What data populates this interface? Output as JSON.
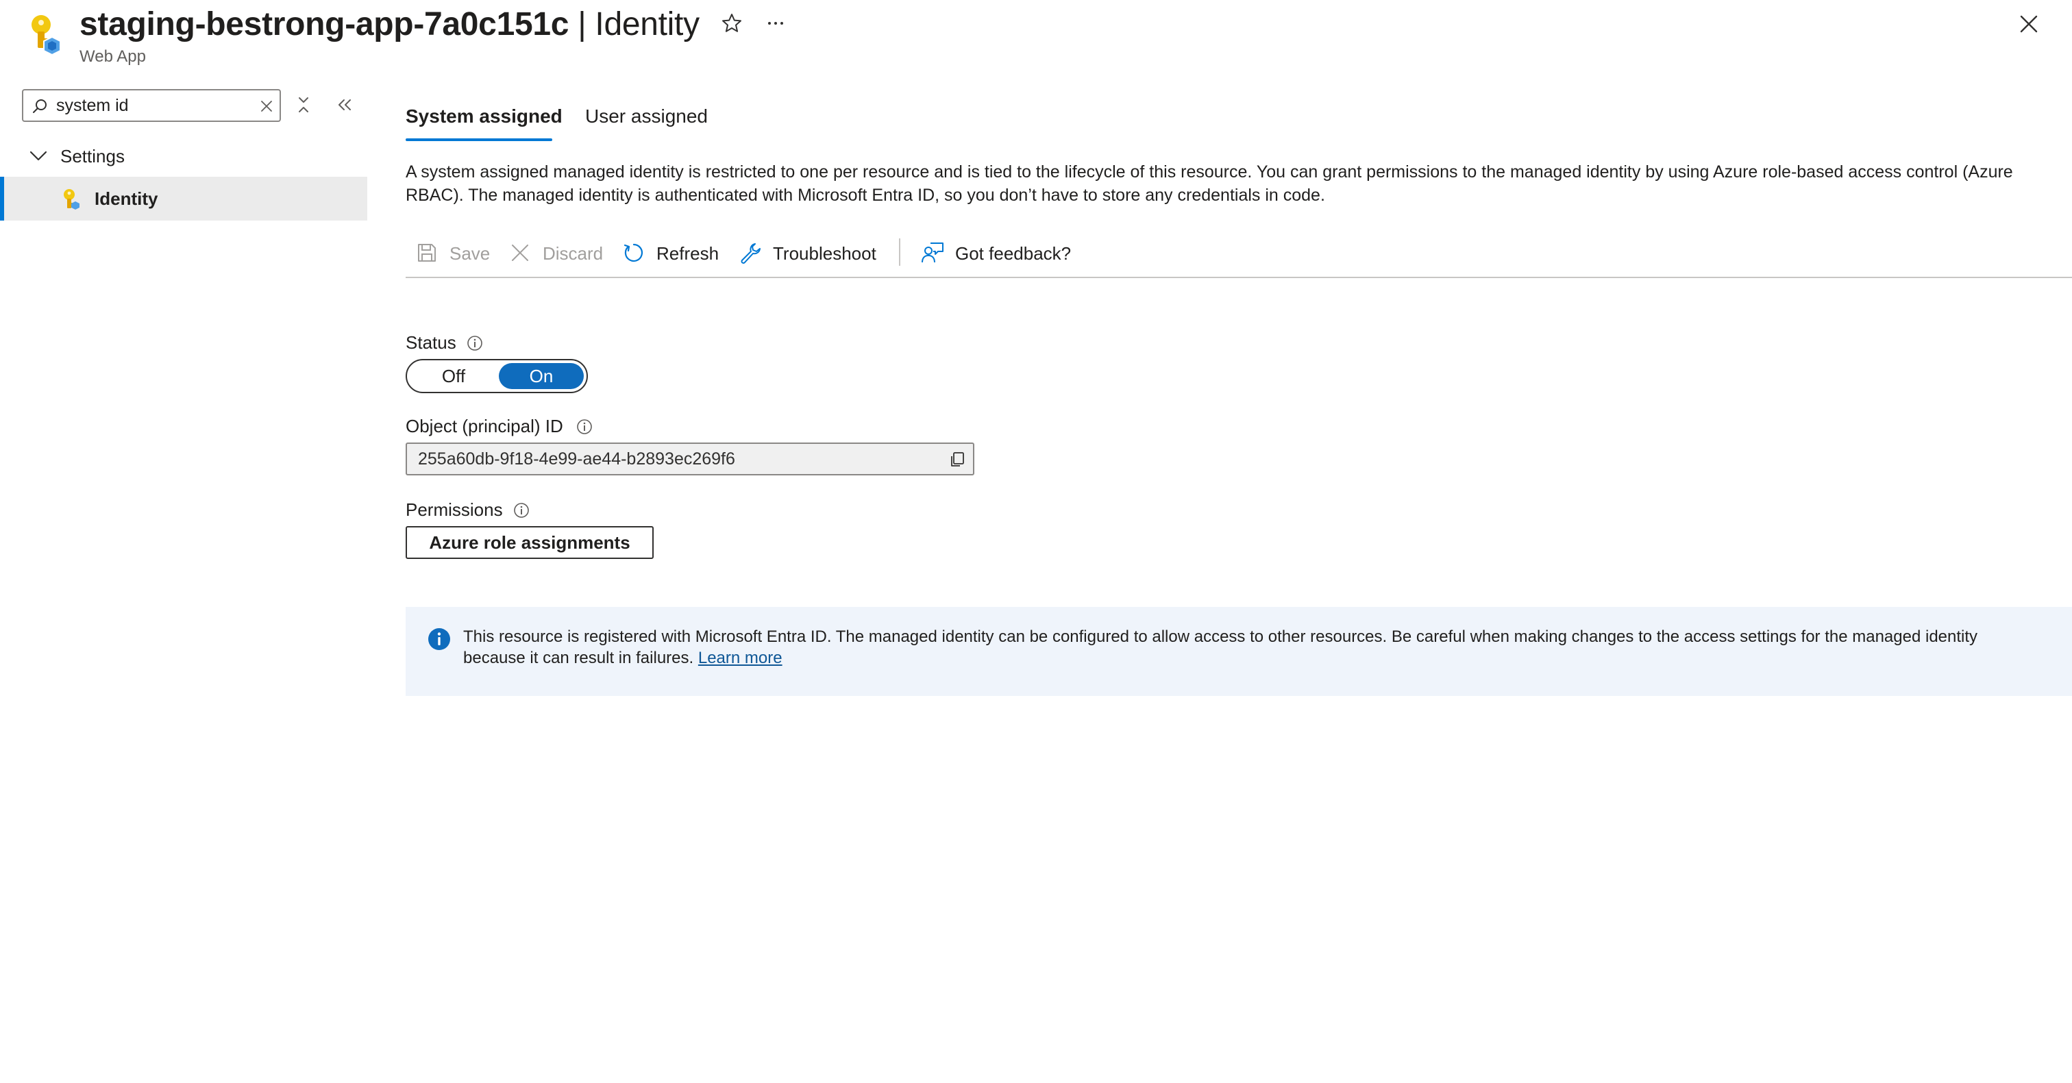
{
  "header": {
    "resource_name": "staging-bestrong-app-7a0c151c",
    "separator": " | ",
    "section": "Identity",
    "subtitle": "Web App"
  },
  "sidebar": {
    "search": {
      "value": "system id",
      "placeholder": "Search"
    },
    "group": {
      "label": "Settings",
      "expanded": true
    },
    "items": [
      {
        "label": "Identity",
        "selected": true
      }
    ]
  },
  "tabs": [
    {
      "label": "System assigned",
      "active": true
    },
    {
      "label": "User assigned",
      "active": false
    }
  ],
  "description": "A system assigned managed identity is restricted to one per resource and is tied to the lifecycle of this resource. You can grant permissions to the managed identity by using Azure role-based access control (Azure RBAC). The managed identity is authenticated with Microsoft Entra ID, so you don’t have to store any credentials in code.",
  "toolbar": {
    "save": "Save",
    "discard": "Discard",
    "refresh": "Refresh",
    "troubleshoot": "Troubleshoot",
    "feedback": "Got feedback?"
  },
  "status": {
    "label": "Status",
    "off_label": "Off",
    "on_label": "On",
    "selected": "On"
  },
  "object_id": {
    "label": "Object (principal) ID",
    "value": "255a60db-9f18-4e99-ae44-b2893ec269f6"
  },
  "permissions": {
    "label": "Permissions",
    "button": "Azure role assignments"
  },
  "info_banner": {
    "text": "This resource is registered with Microsoft Entra ID. The managed identity can be configured to allow access to other resources. Be careful when making changes to the access settings for the managed identity because it can result in failures.",
    "link": "Learn more"
  },
  "colors": {
    "accent": "#0078d4",
    "toggle_on": "#0f6cbd",
    "banner_bg": "#eff4fb",
    "selected_bg": "#ebebeb"
  }
}
